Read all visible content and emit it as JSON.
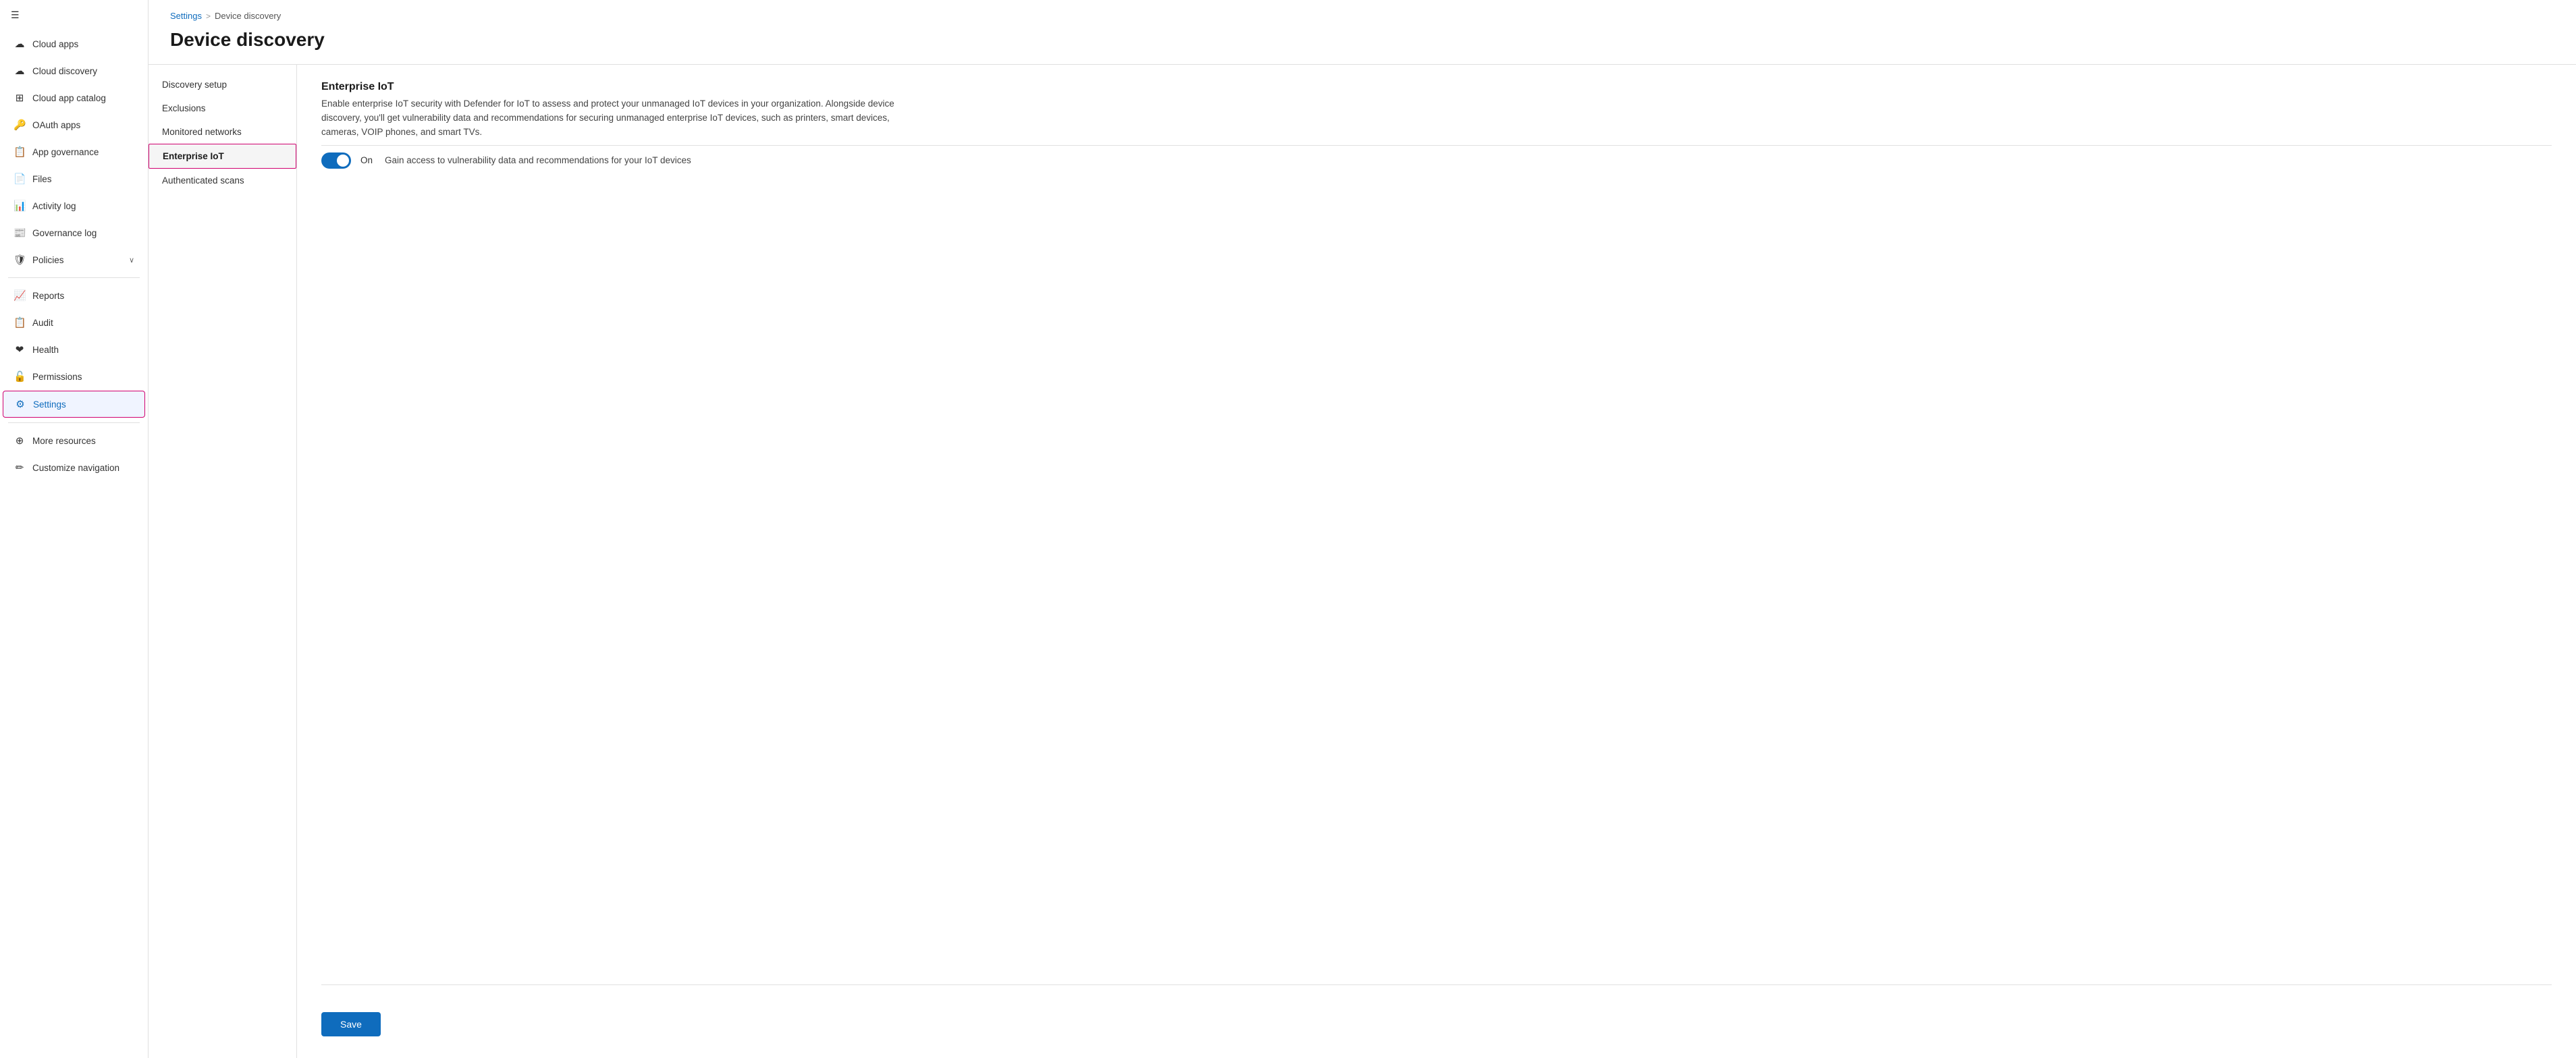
{
  "sidebar": {
    "items": [
      {
        "id": "cloud-apps",
        "label": "Cloud apps",
        "icon": "cloud-discovery"
      },
      {
        "id": "cloud-discovery",
        "label": "Cloud discovery",
        "icon": "cloud-discovery"
      },
      {
        "id": "cloud-app-catalog",
        "label": "Cloud app catalog",
        "icon": "catalog"
      },
      {
        "id": "oauth-apps",
        "label": "OAuth apps",
        "icon": "oauth"
      },
      {
        "id": "app-governance",
        "label": "App governance",
        "icon": "appgov"
      },
      {
        "id": "files",
        "label": "Files",
        "icon": "files"
      },
      {
        "id": "activity-log",
        "label": "Activity log",
        "icon": "actlog"
      },
      {
        "id": "governance-log",
        "label": "Governance log",
        "icon": "govlog"
      },
      {
        "id": "policies",
        "label": "Policies",
        "icon": "policies",
        "hasChevron": true
      },
      {
        "id": "reports",
        "label": "Reports",
        "icon": "reports"
      },
      {
        "id": "audit",
        "label": "Audit",
        "icon": "audit"
      },
      {
        "id": "health",
        "label": "Health",
        "icon": "health"
      },
      {
        "id": "permissions",
        "label": "Permissions",
        "icon": "permissions"
      },
      {
        "id": "settings",
        "label": "Settings",
        "icon": "settings",
        "active": true
      },
      {
        "id": "more-resources",
        "label": "More resources",
        "icon": "more"
      },
      {
        "id": "customize-navigation",
        "label": "Customize navigation",
        "icon": "customize"
      }
    ]
  },
  "breadcrumb": {
    "settings": "Settings",
    "separator": ">",
    "current": "Device discovery"
  },
  "pageTitle": "Device discovery",
  "subnav": {
    "items": [
      {
        "id": "discovery-setup",
        "label": "Discovery setup"
      },
      {
        "id": "exclusions",
        "label": "Exclusions"
      },
      {
        "id": "monitored-networks",
        "label": "Monitored networks"
      },
      {
        "id": "enterprise-iot",
        "label": "Enterprise IoT",
        "active": true
      },
      {
        "id": "authenticated-scans",
        "label": "Authenticated scans"
      }
    ]
  },
  "detail": {
    "title": "Enterprise IoT",
    "description": "Enable enterprise IoT security with Defender for IoT to assess and protect your unmanaged IoT devices in your organization. Alongside device discovery, you'll get vulnerability data and recommendations for securing unmanaged enterprise IoT devices, such as printers, smart devices, cameras, VOIP phones, and smart TVs.",
    "toggle": {
      "state": "On",
      "description": "Gain access to vulnerability data and recommendations for your IoT devices"
    }
  },
  "saveButton": "Save"
}
